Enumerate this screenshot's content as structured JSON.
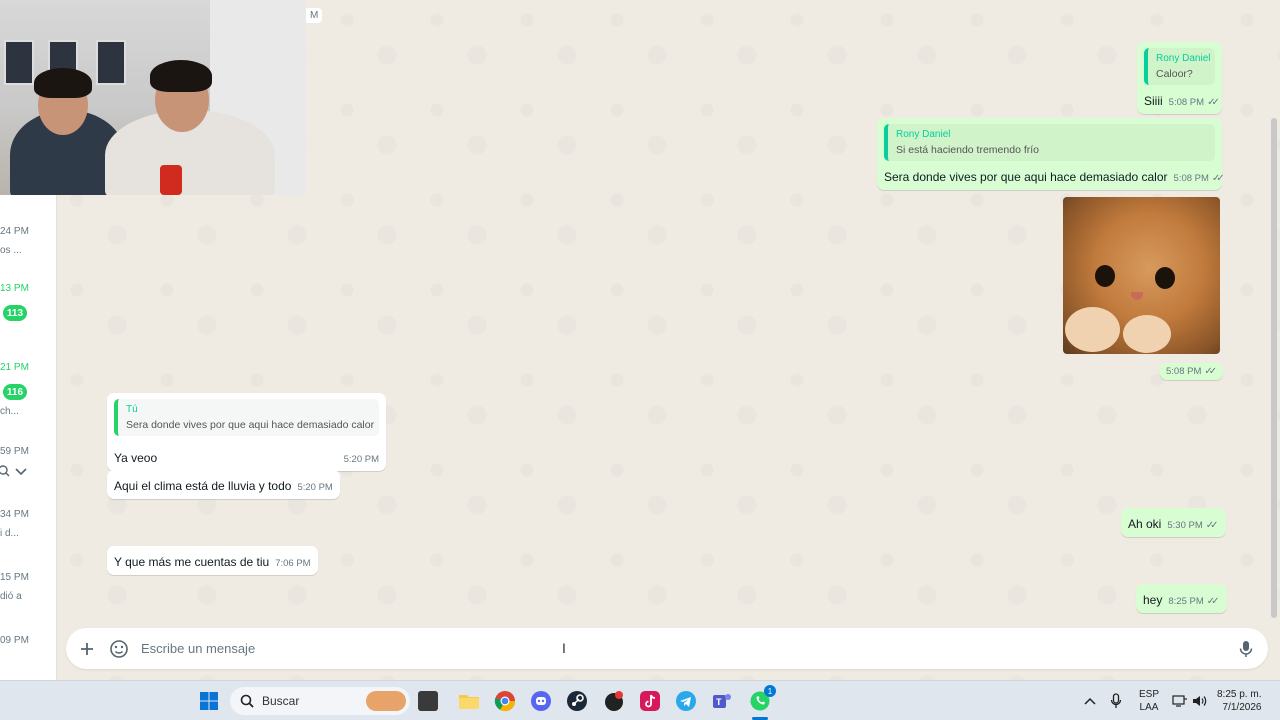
{
  "sidebar": {
    "entries": [
      {
        "time": "24 PM",
        "snippet": "os ..."
      },
      {
        "time": "13 PM",
        "badge": "113"
      },
      {
        "time": "21 PM",
        "badge": "116",
        "snippet": "ch..."
      },
      {
        "time": "59 PM"
      },
      {
        "time": "34 PM",
        "snippet": "i d..."
      },
      {
        "time": "15 PM",
        "snippet": "dió a"
      },
      {
        "time": "09 PM"
      }
    ]
  },
  "overlay": {
    "time_fragment": "M"
  },
  "messages": {
    "m1": {
      "quote_author": "Rony Daniel",
      "quote_text": "Caloor?",
      "text": "Siiii",
      "time": "5:08 PM"
    },
    "m2": {
      "quote_author": "Rony Daniel",
      "quote_text": "Si está haciendo tremendo frío",
      "text": "Sera donde vives por que aqui hace demasiado calor",
      "time": "5:08 PM"
    },
    "m3": {
      "time": "5:08 PM"
    },
    "m4": {
      "quote_author": "Tú",
      "quote_text": "Sera donde vives por que aqui hace demasiado calor",
      "text": "Ya veoo",
      "time": "5:20 PM"
    },
    "m5": {
      "text": "Aqui el clima está de lluvia y todo",
      "time": "5:20 PM"
    },
    "m6": {
      "text": "Y que más me cuentas de tiu",
      "time": "7:06 PM"
    },
    "m7": {
      "text": "Ah oki",
      "time": "5:30 PM"
    },
    "m8": {
      "text": "hey",
      "time": "8:25 PM"
    }
  },
  "composer": {
    "placeholder": "Escribe un mensaje"
  },
  "taskbar": {
    "search_label": "Buscar",
    "lang_top": "ESP",
    "lang_bottom": "LAA",
    "clock_time": "8:25 p. m.",
    "clock_date": "7/1/2026",
    "whatsapp_badge": "1"
  },
  "colors": {
    "accent": "#25d366",
    "outgoing": "#d9fdd3",
    "incoming": "#ffffff",
    "quote_bar": "#06cf9c"
  }
}
